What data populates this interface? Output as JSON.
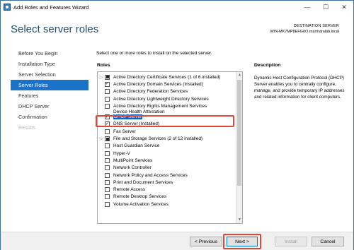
{
  "window": {
    "title": "Add Roles and Features Wizard",
    "minimize_glyph": "—",
    "maximize_glyph": "☐",
    "close_glyph": "✕"
  },
  "header": {
    "page_title": "Select server roles",
    "destination_label": "DESTINATION SERVER",
    "destination_value": "WIN-MK7MP8EFG0O.marmaralab.local"
  },
  "nav": {
    "items": [
      {
        "label": "Before You Begin",
        "state": "normal"
      },
      {
        "label": "Installation Type",
        "state": "normal"
      },
      {
        "label": "Server Selection",
        "state": "normal"
      },
      {
        "label": "Server Roles",
        "state": "active"
      },
      {
        "label": "Features",
        "state": "normal"
      },
      {
        "label": "DHCP Server",
        "state": "normal"
      },
      {
        "label": "Confirmation",
        "state": "normal"
      },
      {
        "label": "Results",
        "state": "disabled"
      }
    ]
  },
  "main": {
    "instruction": "Select one or more roles to install on the selected server.",
    "roles_heading": "Roles",
    "description_heading": "Description",
    "description_text": "Dynamic Host Configuration Protocol (DHCP) Server enables you to centrally configure, manage, and provide temporary IP addresses and related information for client computers."
  },
  "roles": [
    {
      "label": "Active Directory Certificate Services (1 of 6 installed)",
      "state": "partial",
      "expandable": true
    },
    {
      "label": "Active Directory Domain Services (Installed)",
      "state": "checked",
      "expandable": false
    },
    {
      "label": "Active Directory Federation Services",
      "state": "unchecked",
      "expandable": false
    },
    {
      "label": "Active Directory Lightweight Directory Services",
      "state": "unchecked",
      "expandable": false
    },
    {
      "label": "Active Directory Rights Management Services",
      "state": "unchecked",
      "expandable": false
    },
    {
      "label": "Device Health Attestation",
      "state": "clipped",
      "expandable": false
    },
    {
      "label": "DHCP Server",
      "state": "checked",
      "expandable": false,
      "selected": true
    },
    {
      "label": "DNS Server (Installed)",
      "state": "checked",
      "expandable": false
    },
    {
      "label": "Fax Server",
      "state": "unchecked",
      "expandable": false
    },
    {
      "label": "File and Storage Services (2 of 12 installed)",
      "state": "partial",
      "expandable": true
    },
    {
      "label": "Host Guardian Service",
      "state": "unchecked",
      "expandable": false
    },
    {
      "label": "Hyper-V",
      "state": "unchecked",
      "expandable": false
    },
    {
      "label": "MultiPoint Services",
      "state": "unchecked",
      "expandable": false
    },
    {
      "label": "Network Controller",
      "state": "unchecked",
      "expandable": false
    },
    {
      "label": "Network Policy and Access Services",
      "state": "unchecked",
      "expandable": false
    },
    {
      "label": "Print and Document Services",
      "state": "unchecked",
      "expandable": false
    },
    {
      "label": "Remote Access",
      "state": "unchecked",
      "expandable": false
    },
    {
      "label": "Remote Desktop Services",
      "state": "unchecked",
      "expandable": false
    },
    {
      "label": "Volume Activation Services",
      "state": "unchecked",
      "expandable": false
    }
  ],
  "footer": {
    "previous_label": "< Previous",
    "next_label": "Next >",
    "install_label": "Install",
    "cancel_label": "Cancel"
  },
  "colors": {
    "active_nav": "#1a73c8",
    "title_blue": "#1f4e79",
    "highlight_red": "#e0463a",
    "selection_blue": "#0a63c9"
  }
}
